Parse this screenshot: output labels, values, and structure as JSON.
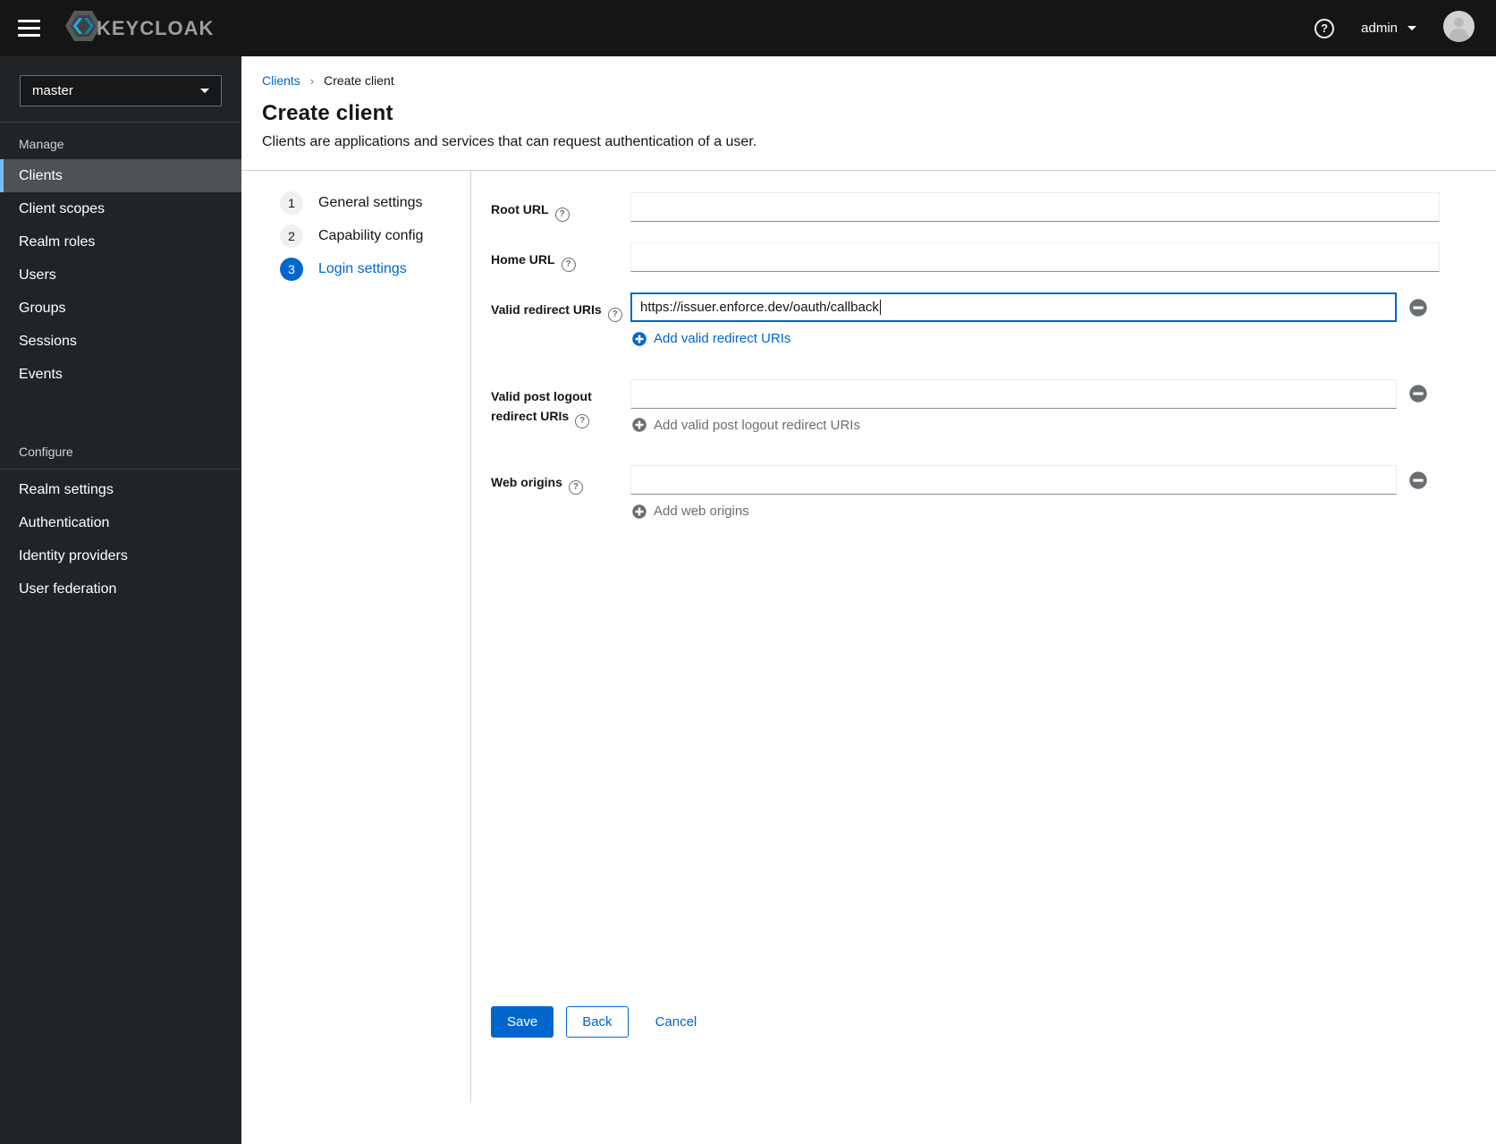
{
  "masthead": {
    "brand": "KEYCLOAK",
    "username": "admin"
  },
  "sidebar": {
    "realm": "master",
    "sections": [
      {
        "title": "Manage",
        "items": [
          {
            "label": "Clients",
            "selected": true
          },
          {
            "label": "Client scopes",
            "selected": false
          },
          {
            "label": "Realm roles",
            "selected": false
          },
          {
            "label": "Users",
            "selected": false
          },
          {
            "label": "Groups",
            "selected": false
          },
          {
            "label": "Sessions",
            "selected": false
          },
          {
            "label": "Events",
            "selected": false
          }
        ]
      },
      {
        "title": "Configure",
        "items": [
          {
            "label": "Realm settings",
            "selected": false
          },
          {
            "label": "Authentication",
            "selected": false
          },
          {
            "label": "Identity providers",
            "selected": false
          },
          {
            "label": "User federation",
            "selected": false
          }
        ]
      }
    ]
  },
  "breadcrumb": {
    "items": [
      "Clients",
      "Create client"
    ]
  },
  "page": {
    "title": "Create client",
    "subtitle": "Clients are applications and services that can request authentication of a user."
  },
  "wizard": {
    "steps": [
      {
        "number": "1",
        "label": "General settings",
        "active": false
      },
      {
        "number": "2",
        "label": "Capability config",
        "active": false
      },
      {
        "number": "3",
        "label": "Login settings",
        "active": true
      }
    ]
  },
  "form": {
    "root_url": {
      "label": "Root URL",
      "value": ""
    },
    "home_url": {
      "label": "Home URL",
      "value": ""
    },
    "valid_redirect_uris": {
      "label": "Valid redirect URIs",
      "value": "https://issuer.enforce.dev/oauth/callback",
      "add_label": "Add valid redirect URIs"
    },
    "valid_post_logout_redirect_uris": {
      "label_line1": "Valid post logout",
      "label_line2": "redirect URIs",
      "value": "",
      "add_label": "Add valid post logout redirect URIs"
    },
    "web_origins": {
      "label": "Web origins",
      "value": "",
      "add_label": "Add web origins"
    },
    "actions": {
      "save": "Save",
      "back": "Back",
      "cancel": "Cancel"
    }
  },
  "icons": {
    "help": "?",
    "plus_circle": "plus-circle",
    "minus_circle": "minus-circle",
    "caret_down": "caret-down"
  },
  "colors": {
    "primary": "#0066cc",
    "masthead_bg": "#151515",
    "sidebar_bg": "#212427",
    "nav_selected_bg": "#4f5255",
    "nav_selected_border": "#73bcf7",
    "disabled_text": "#6a6e73",
    "input_bottom_border": "#8a8d90",
    "divider": "#d2d2d2"
  }
}
